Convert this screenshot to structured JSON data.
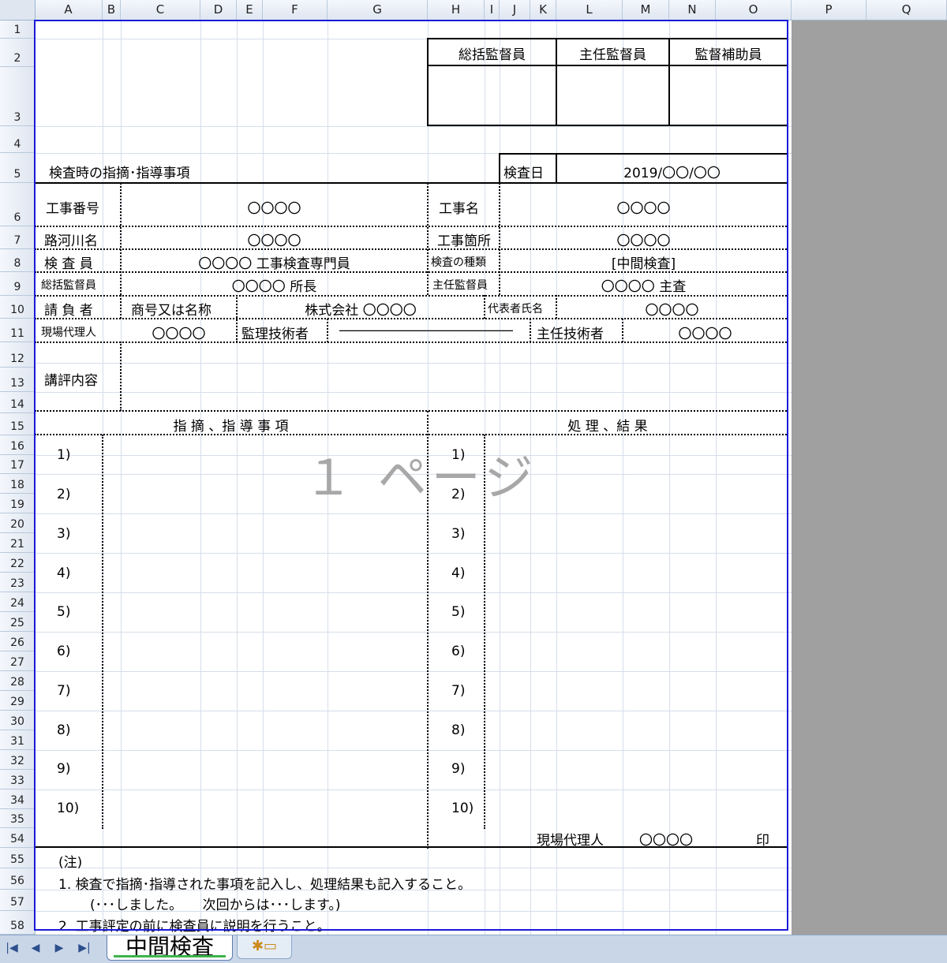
{
  "columns": [
    "A",
    "B",
    "C",
    "D",
    "E",
    "F",
    "G",
    "H",
    "I",
    "J",
    "K",
    "L",
    "M",
    "N",
    "O",
    "P",
    "Q"
  ],
  "rows": [
    "1",
    "2",
    "3",
    "4",
    "5",
    "6",
    "7",
    "8",
    "9",
    "10",
    "11",
    "12",
    "13",
    "14",
    "15",
    "16",
    "17",
    "18",
    "19",
    "20",
    "21",
    "22",
    "23",
    "24",
    "25",
    "26",
    "27",
    "28",
    "29",
    "30",
    "31",
    "32",
    "33",
    "34",
    "35",
    "54",
    "55",
    "56",
    "57",
    "58"
  ],
  "sign": {
    "chief": "総括監督員",
    "supervisor": "主任監督員",
    "assistant": "監督補助員"
  },
  "title": "検査時の指摘･指導事項",
  "inspection_date_label": "検査日",
  "inspection_date": "2019/〇〇/〇〇",
  "info": {
    "work_no_label": "工事番号",
    "work_no": "〇〇〇〇",
    "work_name_label": "工事名",
    "work_name": "〇〇〇〇",
    "river_label": "路河川名",
    "river": "〇〇〇〇",
    "site_label": "工事箇所",
    "site": "〇〇〇〇",
    "inspector_label": "検 査 員",
    "inspector": "〇〇〇〇 工事検査専門員",
    "type_label": "検査の種類",
    "type": "[中間検査]",
    "chief_label": "総括監督員",
    "chief": "〇〇〇〇 所長",
    "sup_label": "主任監督員",
    "sup": "〇〇〇〇 主査",
    "contractor_label": "請 負 者",
    "trade_name_label": "商号又は名称",
    "company": "株式会社 〇〇〇〇",
    "rep_label": "代表者氏名",
    "rep": "〇〇〇〇",
    "site_agent_label": "現場代理人",
    "site_agent": "〇〇〇〇",
    "manager_label": "監理技術者",
    "manager": "――――――――――――――",
    "chief_engineer_label": "主任技術者",
    "chief_engineer": "〇〇〇〇",
    "eval_label": "講評内容"
  },
  "section_left": "指 摘 、指 導 事 項",
  "section_right": "処 理 、結 果",
  "items": [
    "1)",
    "2)",
    "3)",
    "4)",
    "5)",
    "6)",
    "7)",
    "8)",
    "9)",
    "10)"
  ],
  "watermark": "１ ページ",
  "footer_sign": {
    "label": "現場代理人",
    "name": "〇〇〇〇",
    "seal": "印"
  },
  "notes": {
    "head": "(注)",
    "line1": "1. 検査で指摘･指導された事項を記入し、処理結果も記入すること。",
    "line2": "(･･･しました。　　次回からは･･･します。)",
    "line3": "2. 工事評定の前に検査員に説明を行うこと。"
  },
  "sheet_tab": "中間検査"
}
